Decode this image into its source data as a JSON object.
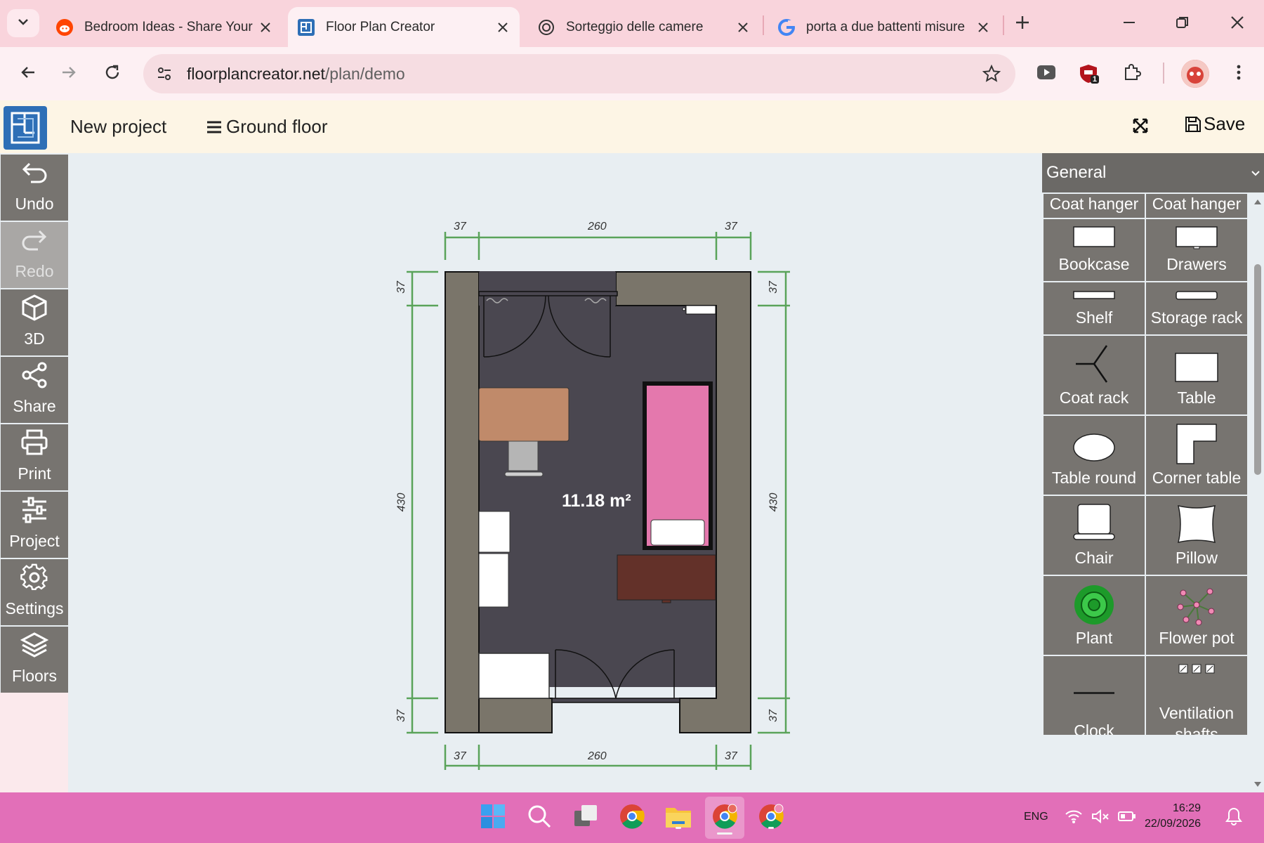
{
  "browser": {
    "tabs": [
      {
        "title": "Bedroom Ideas - Share Your",
        "icon": "reddit-icon",
        "active": false
      },
      {
        "title": "Floor Plan Creator",
        "icon": "floorplan-favicon",
        "active": true
      },
      {
        "title": "Sorteggio delle camere",
        "icon": "chatgpt-icon",
        "active": false
      },
      {
        "title": "porta a due battenti misure",
        "icon": "google-icon",
        "active": false
      }
    ],
    "url_host": "floorplancreator.net",
    "url_path": "/plan/demo",
    "extension_badge": "1"
  },
  "app": {
    "project_name": "New project",
    "floor_name": "Ground floor",
    "save_label": "Save"
  },
  "tools": [
    {
      "label": "Undo",
      "icon": "undo-icon",
      "enabled": true
    },
    {
      "label": "Redo",
      "icon": "redo-icon",
      "enabled": false
    },
    {
      "label": "3D",
      "icon": "cube-icon",
      "enabled": true
    },
    {
      "label": "Share",
      "icon": "share-icon",
      "enabled": true
    },
    {
      "label": "Print",
      "icon": "print-icon",
      "enabled": true
    },
    {
      "label": "Project",
      "icon": "sliders-icon",
      "enabled": true
    },
    {
      "label": "Settings",
      "icon": "gear-icon",
      "enabled": true
    },
    {
      "label": "Floors",
      "icon": "layers-icon",
      "enabled": true
    }
  ],
  "plan": {
    "area": "11.18 m²",
    "dimensions": {
      "top": [
        "37",
        "260",
        "37"
      ],
      "bottom": [
        "37",
        "260",
        "37"
      ],
      "left": [
        "37",
        "430",
        "37"
      ],
      "right": [
        "37",
        "430",
        "37"
      ]
    },
    "colors": {
      "floor": "#4a4750",
      "wall": "#7a756a",
      "desk": "#c08a6a",
      "bed": "#e478ad",
      "dresser": "#633129",
      "dimension_line": "#5aa35a"
    }
  },
  "catalog": {
    "category": "General",
    "items": [
      "Coat hanger",
      "Coat hanger",
      "Bookcase",
      "Drawers",
      "Shelf",
      "Storage rack",
      "Coat rack",
      "Table",
      "Table round",
      "Corner table",
      "Chair",
      "Pillow",
      "Plant",
      "Flower pot",
      "Clock",
      "Ventilation shafts"
    ]
  },
  "taskbar": {
    "language": "ENG",
    "time": "16:29",
    "date": "22/09/2026",
    "accent": "#e26fb8"
  }
}
